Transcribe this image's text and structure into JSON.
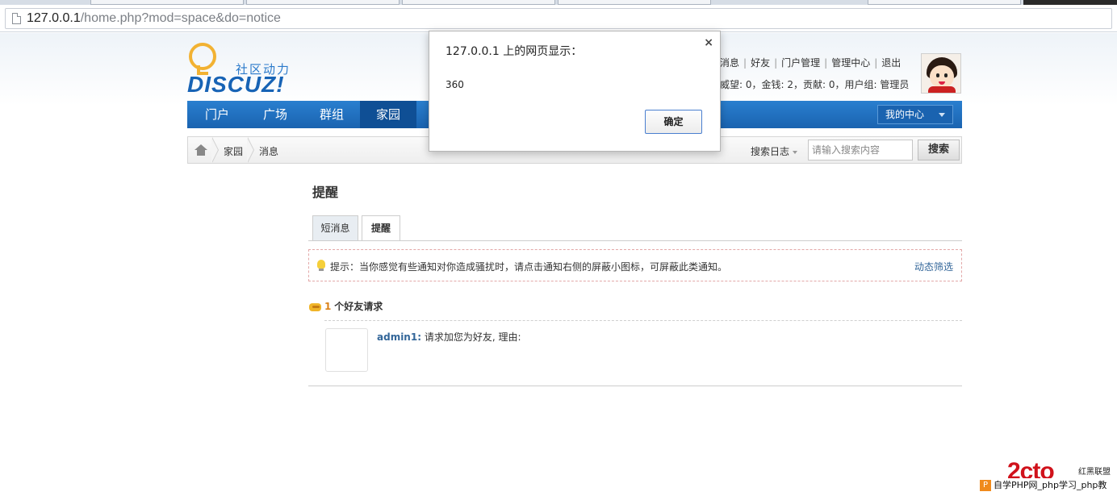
{
  "browser": {
    "url_host": "127.0.0.1",
    "url_path": "/home.php?mod=space&do=notice"
  },
  "logo": {
    "tagline": "社区动力",
    "wordmark": "DISCUZ!",
    "brand_color": "#1763b5",
    "bulb_color": "#f2b233"
  },
  "user_bar": {
    "links": [
      "短消息",
      "好友",
      "门户管理",
      "管理中心",
      "退出"
    ],
    "credits": "，威望: 0，金钱: 2，贡献: 0，用户组: 管理员"
  },
  "nav": {
    "items": [
      "门户",
      "广场",
      "群组",
      "家园"
    ],
    "active": "家园",
    "my_center": "我的中心",
    "color": "#1a63b0"
  },
  "breadcrumb": {
    "items": [
      "家园",
      "消息"
    ]
  },
  "search": {
    "type_label": "搜索日志",
    "placeholder": "请输入搜索内容",
    "button": "搜索"
  },
  "main": {
    "title": "提醒",
    "tabs": [
      "短消息",
      "提醒"
    ],
    "active_tab": "提醒",
    "tip_text": "提示：当你感觉有些通知对你造成骚扰时，请点击通知右侧的屏蔽小图标，可屏蔽此类通知。",
    "tip_filter": "动态筛选",
    "request_count": "1",
    "request_label": "个好友请求",
    "request_user": "admin1:",
    "request_message": "请求加您为好友, 理由:"
  },
  "dialog": {
    "title": "127.0.0.1 上的网页显示：",
    "close": "×",
    "message": "360",
    "ok_button": "确定"
  },
  "watermark": {
    "logo_text": "2cto",
    "side_text": "红黑联盟",
    "bar_icon": "P",
    "bar_text": "自学PHP网_php学习_php教"
  }
}
